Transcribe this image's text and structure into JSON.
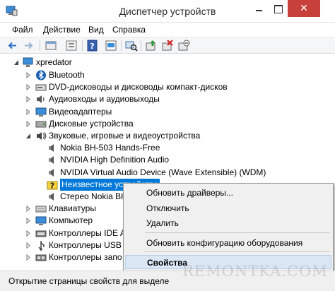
{
  "window": {
    "title": "Диспетчер устройств",
    "close_glyph": "✕"
  },
  "menu": [
    "Файл",
    "Действие",
    "Вид",
    "Справка"
  ],
  "toolbar_icons": [
    "back-icon",
    "forward-icon",
    "properties-icon",
    "hide-show-icon",
    "help-icon",
    "device-view-icon",
    "scan-hardware-icon",
    "update-driver-icon",
    "uninstall-icon",
    "disable-icon"
  ],
  "tree": {
    "root": "xpredator",
    "items": [
      {
        "label": "Bluetooth",
        "icon": "bluetooth-icon",
        "expander": "collapsed"
      },
      {
        "label": "DVD-дисководы и дисководы компакт-дисков",
        "icon": "dvd-drive-icon",
        "expander": "collapsed"
      },
      {
        "label": "Аудиовходы и аудиовыходы",
        "icon": "audio-io-icon",
        "expander": "collapsed"
      },
      {
        "label": "Видеоадаптеры",
        "icon": "display-adapter-icon",
        "expander": "collapsed"
      },
      {
        "label": "Дисковые устройства",
        "icon": "disk-drive-icon",
        "expander": "collapsed"
      },
      {
        "label": "Звуковые, игровые и видеоустройства",
        "icon": "sound-icon",
        "expander": "expanded"
      },
      {
        "label": "Nokia BH-503 Hands-Free",
        "icon": "speaker-icon",
        "child": true
      },
      {
        "label": "NVIDIA High Definition Audio",
        "icon": "speaker-icon",
        "child": true
      },
      {
        "label": "NVIDIA Virtual Audio Device (Wave Extensible) (WDM)",
        "icon": "speaker-icon",
        "child": true
      },
      {
        "label": "Неизвестное устройство",
        "icon": "unknown-device-icon",
        "child": true,
        "selected": true
      },
      {
        "label": "Стерео Nokia BH",
        "icon": "speaker-icon",
        "child": true
      },
      {
        "label": "Клавиатуры",
        "icon": "keyboard-icon",
        "expander": "collapsed"
      },
      {
        "label": "Компьютер",
        "icon": "computer-icon",
        "expander": "collapsed"
      },
      {
        "label": "Контроллеры IDE A",
        "icon": "ide-controller-icon",
        "expander": "collapsed"
      },
      {
        "label": "Контроллеры USB",
        "icon": "usb-controller-icon",
        "expander": "collapsed"
      },
      {
        "label": "Контроллеры запо",
        "icon": "storage-controller-icon",
        "expander": "collapsed"
      }
    ]
  },
  "context_menu": {
    "items": [
      {
        "label": "Обновить драйверы...",
        "bold": false,
        "hover": false
      },
      {
        "label": "Отключить",
        "bold": false,
        "hover": false
      },
      {
        "label": "Удалить",
        "bold": false,
        "hover": false
      },
      {
        "label": "Обновить конфигурацию оборудования",
        "bold": false,
        "hover": false,
        "separator_before": true
      },
      {
        "label": "Свойства",
        "bold": true,
        "hover": true,
        "separator_before": true
      }
    ]
  },
  "status": {
    "text": "Открытие страницы свойств для выделе"
  },
  "watermark": "REMONTKA.COM",
  "colors": {
    "selection": "#0078d7",
    "close_button": "#c7403a",
    "menu_hover": "#dae6f4"
  }
}
